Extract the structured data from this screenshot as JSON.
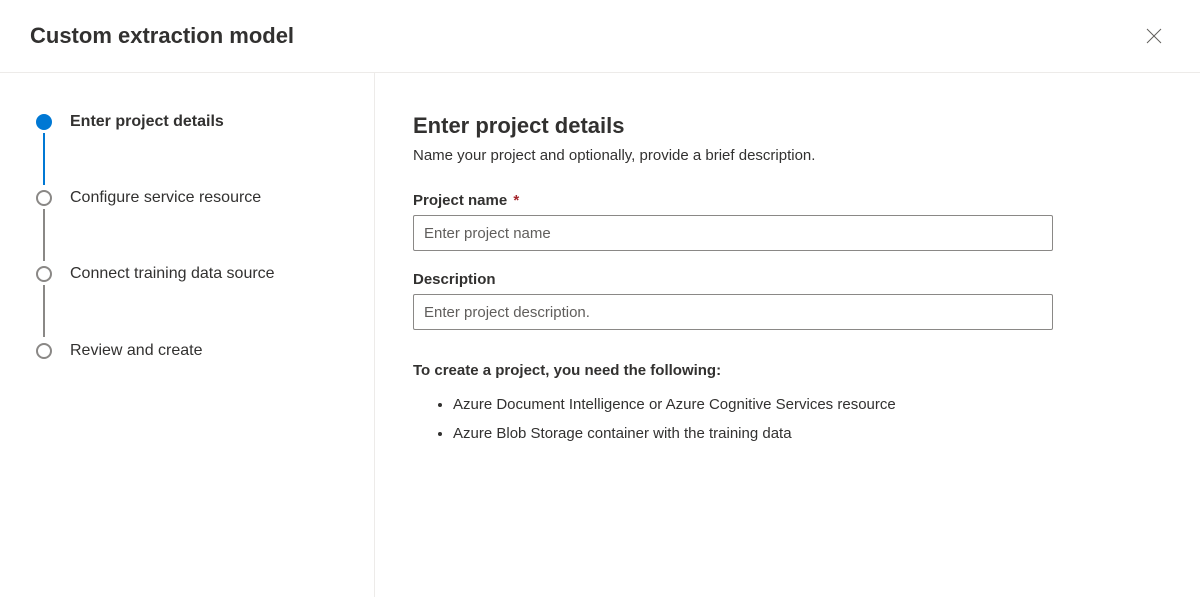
{
  "header": {
    "title": "Custom extraction model"
  },
  "sidebar": {
    "steps": [
      {
        "label": "Enter project details",
        "active": true
      },
      {
        "label": "Configure service resource",
        "active": false
      },
      {
        "label": "Connect training data source",
        "active": false
      },
      {
        "label": "Review and create",
        "active": false
      }
    ]
  },
  "main": {
    "title": "Enter project details",
    "subtitle": "Name your project and optionally, provide a brief description.",
    "fields": {
      "projectName": {
        "label": "Project name",
        "placeholder": "Enter project name",
        "value": "",
        "required_mark": "*"
      },
      "description": {
        "label": "Description",
        "placeholder": "Enter project description.",
        "value": ""
      }
    },
    "info": {
      "heading": "To create a project, you need the following:",
      "items": [
        "Azure Document Intelligence or Azure Cognitive Services resource",
        "Azure Blob Storage container with the training data"
      ]
    }
  }
}
